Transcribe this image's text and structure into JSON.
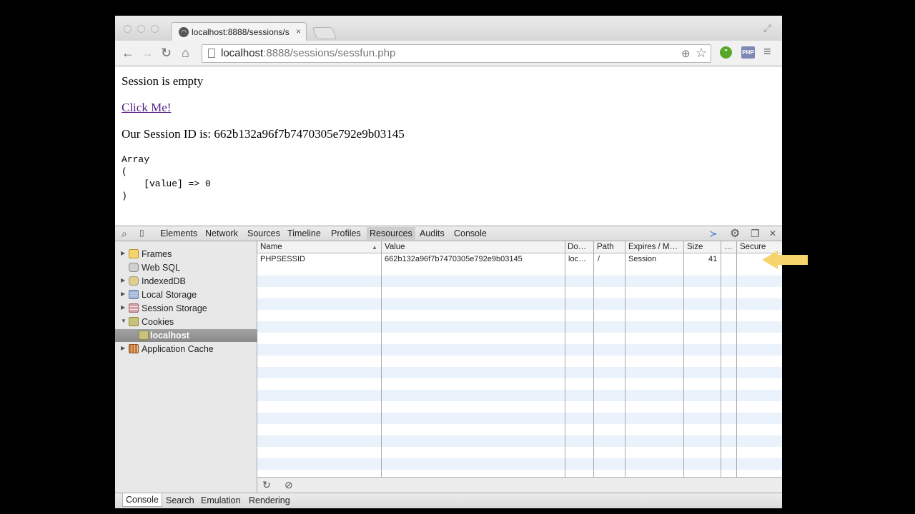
{
  "browser": {
    "tab_title": "localhost:8888/sessions/s",
    "tab_close": "×",
    "url_host": "localhost",
    "url_rest": ":8888/sessions/sessfun.php",
    "ext_php": "PHP"
  },
  "page": {
    "line1": "Session is empty",
    "link": "Click Me!",
    "session_line": "Our Session ID is: 662b132a96f7b7470305e792e9b03145",
    "pre": "Array\n(\n    [value] => 0\n)"
  },
  "devtools": {
    "tabs": [
      "Elements",
      "Network",
      "Sources",
      "Timeline",
      "Profiles",
      "Resources",
      "Audits",
      "Console"
    ],
    "active_tab": "Resources",
    "sidebar": [
      {
        "label": "Frames",
        "expand": "▶"
      },
      {
        "label": "Web SQL",
        "expand": ""
      },
      {
        "label": "IndexedDB",
        "expand": "▶"
      },
      {
        "label": "Local Storage",
        "expand": "▶"
      },
      {
        "label": "Session Storage",
        "expand": "▶"
      },
      {
        "label": "Cookies",
        "expand": "▼"
      },
      {
        "label": "localhost",
        "expand": ""
      },
      {
        "label": "Application Cache",
        "expand": "▶"
      }
    ],
    "columns": [
      "Name",
      "Value",
      "Do…",
      "Path",
      "Expires / M…",
      "Size",
      "…",
      "Secure"
    ],
    "cookies": [
      {
        "name": "PHPSESSID",
        "value": "662b132a96f7b7470305e792e9b03145",
        "domain": "loc…",
        "path": "/",
        "expires": "Session",
        "size": "41",
        "http": "",
        "secure": ""
      }
    ],
    "drawer_tabs": [
      "Console",
      "Search",
      "Emulation",
      "Rendering"
    ]
  },
  "colors": {
    "callout_arrow": "#f6d36b",
    "selected_row": "#9a9a9a",
    "link": "#551a8b"
  }
}
